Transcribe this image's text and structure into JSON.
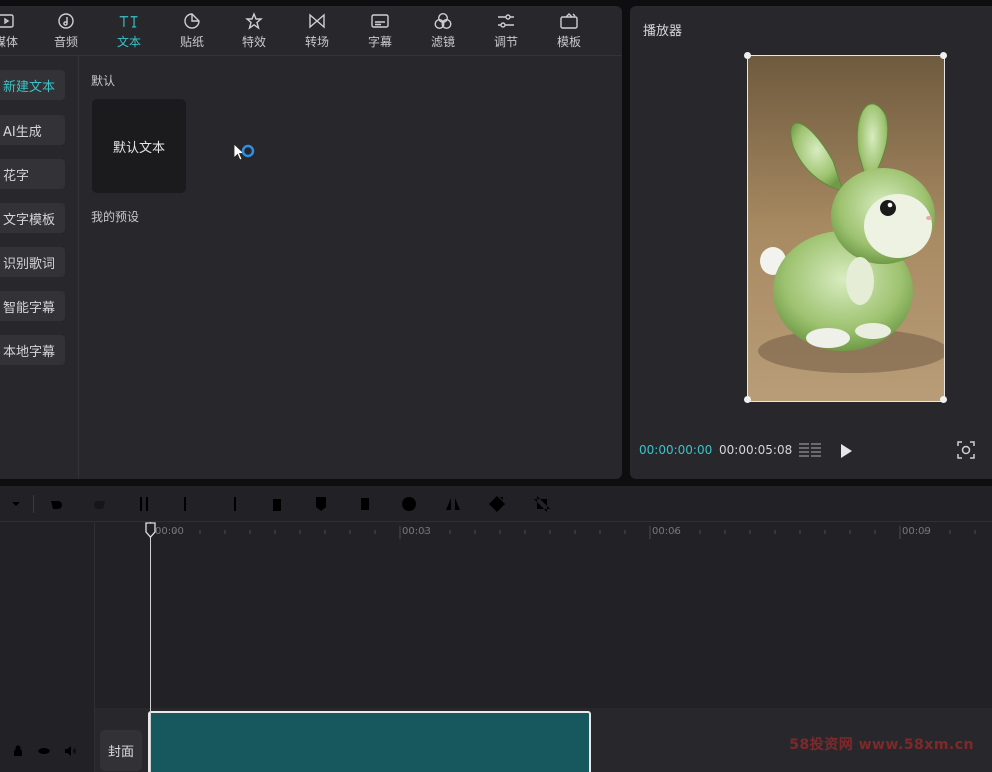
{
  "tabs": [
    {
      "label": "媒体",
      "icon": "media-icon"
    },
    {
      "label": "音频",
      "icon": "audio-icon"
    },
    {
      "label": "文本",
      "icon": "text-icon",
      "active": true
    },
    {
      "label": "贴纸",
      "icon": "sticker-icon"
    },
    {
      "label": "特效",
      "icon": "effects-icon"
    },
    {
      "label": "转场",
      "icon": "transition-icon"
    },
    {
      "label": "字幕",
      "icon": "subtitle-icon"
    },
    {
      "label": "滤镜",
      "icon": "filter-icon"
    },
    {
      "label": "调节",
      "icon": "adjust-icon"
    },
    {
      "label": "模板",
      "icon": "template-icon"
    }
  ],
  "sidebar": {
    "items": [
      {
        "label": "新建文本",
        "active": true
      },
      {
        "label": "AI生成"
      },
      {
        "label": "花字"
      },
      {
        "label": "文字模板"
      },
      {
        "label": "识别歌词"
      },
      {
        "label": "智能字幕"
      },
      {
        "label": "本地字幕"
      }
    ]
  },
  "content": {
    "default_section": "默认",
    "default_card": "默认文本",
    "presets_section": "我的预设"
  },
  "player": {
    "title": "播放器",
    "time_current": "00:00:00:00",
    "time_total": "00:00:05:08"
  },
  "timeline": {
    "ticks": [
      "00:00",
      "00:03",
      "00:06",
      "00:09"
    ],
    "cover_label": "封面"
  },
  "watermark": "58投资网 www.58xm.cn",
  "colors": {
    "accent": "#3ac3c9",
    "panel": "#28282c",
    "clip": "#17585e"
  }
}
